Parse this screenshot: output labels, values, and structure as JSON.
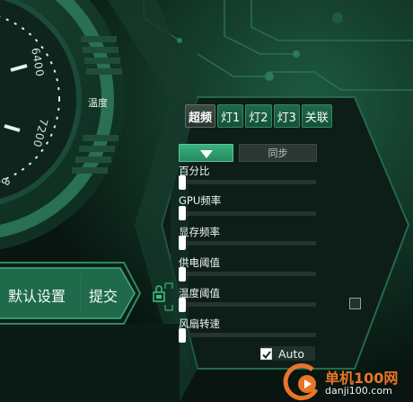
{
  "gauge": {
    "ticks": [
      "6400",
      "7200",
      "8"
    ],
    "temperature_label": "温度"
  },
  "tabs": [
    {
      "label": "超频",
      "active": true
    },
    {
      "label": "灯1",
      "active": false
    },
    {
      "label": "灯2",
      "active": false
    },
    {
      "label": "灯3",
      "active": false
    },
    {
      "label": "关联",
      "active": false
    }
  ],
  "controls": {
    "sync_label": "同步"
  },
  "sliders": [
    {
      "label": "百分比",
      "value": 0
    },
    {
      "label": "GPU频率",
      "value": 0
    },
    {
      "label": "显存频率",
      "value": 0
    },
    {
      "label": "供电阈值",
      "value": 0
    },
    {
      "label": "温度阈值",
      "value": 0
    },
    {
      "label": "风扇转速",
      "value": 0
    }
  ],
  "auto": {
    "label": "Auto",
    "checked": true
  },
  "side_checkbox": {
    "checked": false
  },
  "actions": {
    "default_label": "默认设置",
    "submit_label": "提交"
  },
  "watermark": {
    "title": "单机100网",
    "url": "danji100.com"
  },
  "colors": {
    "accent": "#2f9a6b",
    "background": "#0a1a14",
    "watermark": "#e8752a"
  }
}
